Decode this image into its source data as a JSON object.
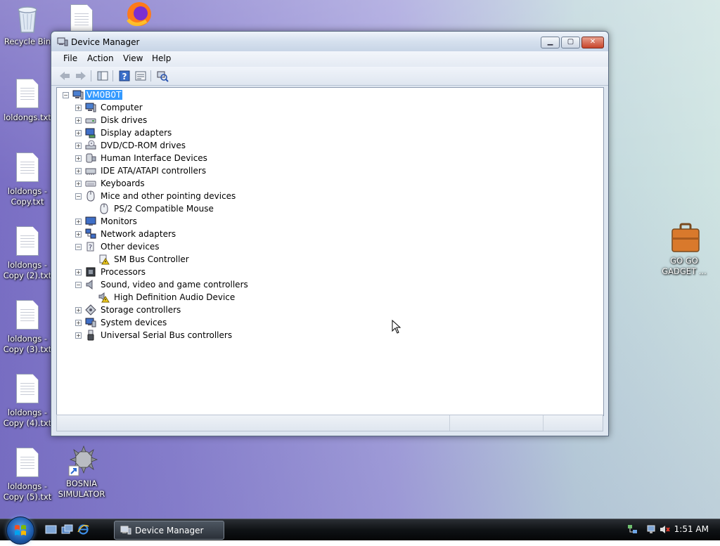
{
  "window": {
    "title": "Device Manager",
    "menu": [
      "File",
      "Action",
      "View",
      "Help"
    ]
  },
  "tree": {
    "root": "VM0B0T",
    "items": [
      {
        "label": "Computer",
        "icon": "computer-icon",
        "expanded": false,
        "level": 1
      },
      {
        "label": "Disk drives",
        "icon": "disk-drive-icon",
        "expanded": false,
        "level": 1
      },
      {
        "label": "Display adapters",
        "icon": "display-adapter-icon",
        "expanded": false,
        "level": 1
      },
      {
        "label": "DVD/CD-ROM drives",
        "icon": "dvd-drive-icon",
        "expanded": false,
        "level": 1
      },
      {
        "label": "Human Interface Devices",
        "icon": "hid-icon",
        "expanded": false,
        "level": 1
      },
      {
        "label": "IDE ATA/ATAPI controllers",
        "icon": "ide-controller-icon",
        "expanded": false,
        "level": 1
      },
      {
        "label": "Keyboards",
        "icon": "keyboard-icon",
        "expanded": false,
        "level": 1
      },
      {
        "label": "Mice and other pointing devices",
        "icon": "mouse-icon",
        "expanded": true,
        "level": 1
      },
      {
        "label": "PS/2 Compatible Mouse",
        "icon": "mouse-icon",
        "level": 2
      },
      {
        "label": "Monitors",
        "icon": "monitor-icon",
        "expanded": false,
        "level": 1
      },
      {
        "label": "Network adapters",
        "icon": "network-adapter-icon",
        "expanded": false,
        "level": 1
      },
      {
        "label": "Other devices",
        "icon": "unknown-device-icon",
        "expanded": true,
        "level": 1
      },
      {
        "label": "SM Bus Controller",
        "icon": "warning-device-icon",
        "level": 2
      },
      {
        "label": "Processors",
        "icon": "processor-icon",
        "expanded": false,
        "level": 1
      },
      {
        "label": "Sound, video and game controllers",
        "icon": "speaker-icon",
        "expanded": true,
        "level": 1
      },
      {
        "label": "High Definition Audio Device",
        "icon": "warning-speaker-icon",
        "level": 2
      },
      {
        "label": "Storage controllers",
        "icon": "storage-controller-icon",
        "expanded": false,
        "level": 1
      },
      {
        "label": "System devices",
        "icon": "system-devices-icon",
        "expanded": false,
        "level": 1
      },
      {
        "label": "Universal Serial Bus controllers",
        "icon": "usb-icon",
        "expanded": false,
        "level": 1
      }
    ]
  },
  "desktop": {
    "icons": [
      {
        "label": "Recycle Bin",
        "icon": "recycle-bin-icon"
      },
      {
        "label": "loldongs.txt",
        "icon": "text-file-icon"
      },
      {
        "label": "loldongs - Copy.txt",
        "icon": "text-file-icon"
      },
      {
        "label": "loldongs - Copy (2).txt",
        "icon": "text-file-icon"
      },
      {
        "label": "loldongs - Copy (3).txt",
        "icon": "text-file-icon"
      },
      {
        "label": "loldongs - Copy (4).txt",
        "icon": "text-file-icon"
      },
      {
        "label": "loldongs - Copy (5).txt",
        "icon": "text-file-icon"
      },
      {
        "label": "BOSNIA SIMULATOR",
        "icon": "spiked-ball-icon"
      },
      {
        "label": "GO GO GADGET ...",
        "icon": "briefcase-icon"
      }
    ]
  },
  "taskbar": {
    "task_label": "Device Manager",
    "clock": "1:51 AM"
  },
  "colors": {
    "selection": "#3399ff",
    "taskbar": "#0f1215"
  }
}
